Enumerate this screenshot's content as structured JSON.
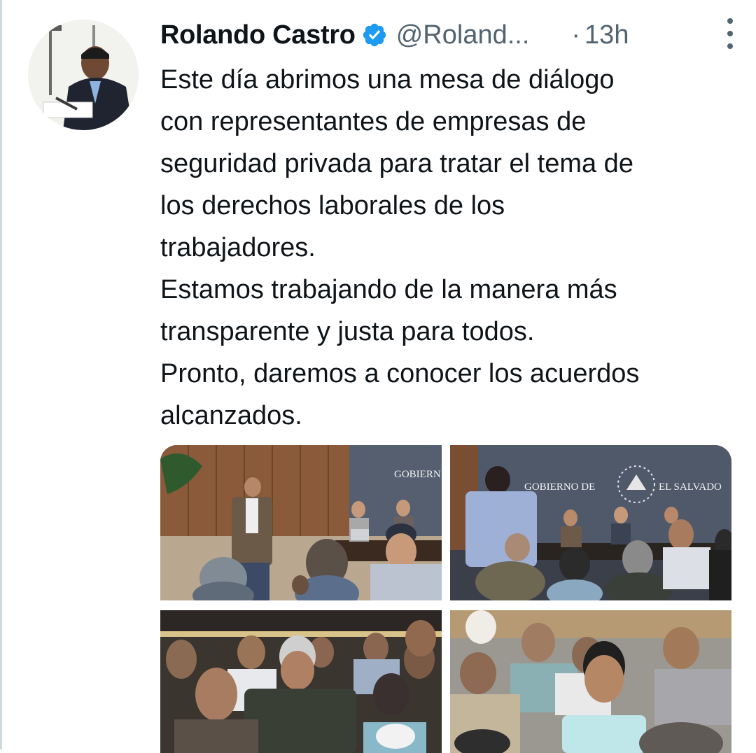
{
  "author": {
    "name": "Rolando Castro",
    "handle": "@Roland...",
    "verified": true,
    "avatar_icon": "profile-photo"
  },
  "meta": {
    "separator": "·",
    "time": "13h",
    "more_icon": "vertical-ellipsis-icon"
  },
  "tweet": {
    "lines": [
      "Este día abrimos una mesa de diálogo",
      "con representantes de empresas de",
      "seguridad privada para tratar el tema de",
      "los derechos laborales de los",
      "trabajadores.",
      "Estamos trabajando de la manera más",
      "transparente y justa para todos.",
      "Pronto, daremos a conocer los acuerdos",
      "alcanzados."
    ]
  },
  "media": {
    "sign_1": "GOBIERN",
    "sign_2_left": "GOBIERNO DE",
    "sign_2_right": "EL SALVADO"
  },
  "colors": {
    "text": "#0f1419",
    "secondary": "#536471",
    "verified": "#1d9bf0",
    "divider": "#cfd9de"
  }
}
